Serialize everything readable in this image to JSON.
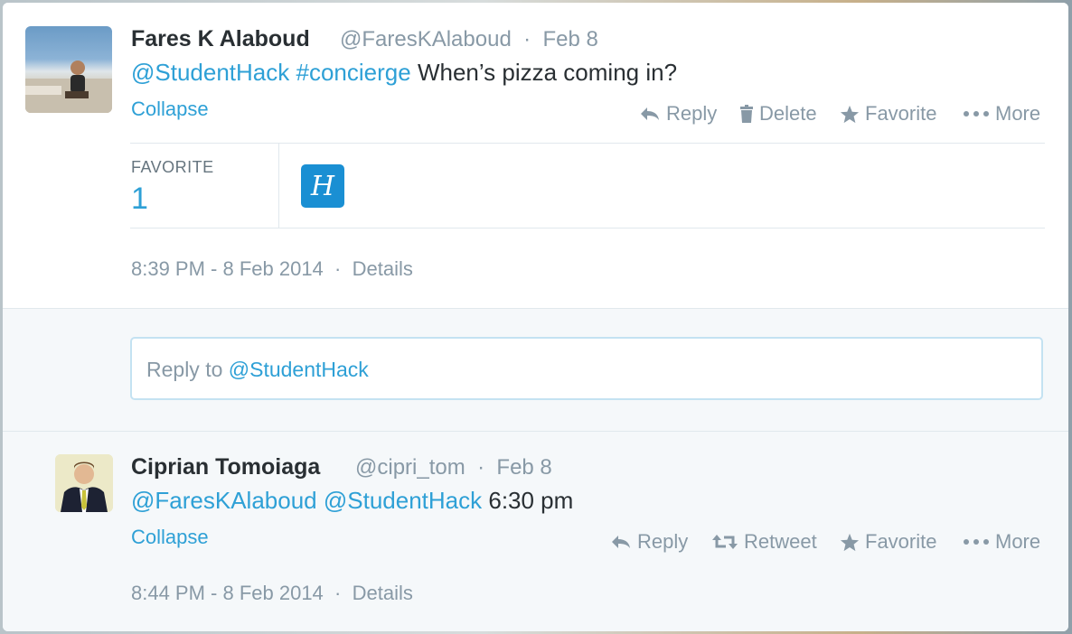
{
  "tweet1": {
    "name": "Fares K Alaboud",
    "handle": "@FaresKAlaboud",
    "date": "Feb 8",
    "mention": "@StudentHack",
    "hashtag": "#concierge",
    "text_rest": "When’s pizza coming in?",
    "collapse": "Collapse",
    "actions": {
      "reply": "Reply",
      "delete": "Delete",
      "favorite": "Favorite",
      "more": "More"
    },
    "stats": {
      "favorite_label": "FAVORITE",
      "favorite_count": "1"
    },
    "favoriter_initial": "H",
    "timestamp": "8:39 PM - 8 Feb 2014",
    "details": "Details"
  },
  "reply_box": {
    "prefix": "Reply to",
    "mention": "@StudentHack"
  },
  "tweet2": {
    "name": "Ciprian Tomoiaga",
    "handle": "@cipri_tom",
    "date": "Feb 8",
    "mention1": "@FaresKAlaboud",
    "mention2": "@StudentHack",
    "text_rest": "6:30 pm",
    "collapse": "Collapse",
    "actions": {
      "reply": "Reply",
      "retweet": "Retweet",
      "favorite": "Favorite",
      "more": "More"
    },
    "timestamp": "8:44 PM - 8 Feb 2014",
    "details": "Details"
  },
  "colors": {
    "link": "#2ea0d6",
    "muted": "#8899a6",
    "text": "#292f33",
    "panel": "#f5f8fa"
  }
}
